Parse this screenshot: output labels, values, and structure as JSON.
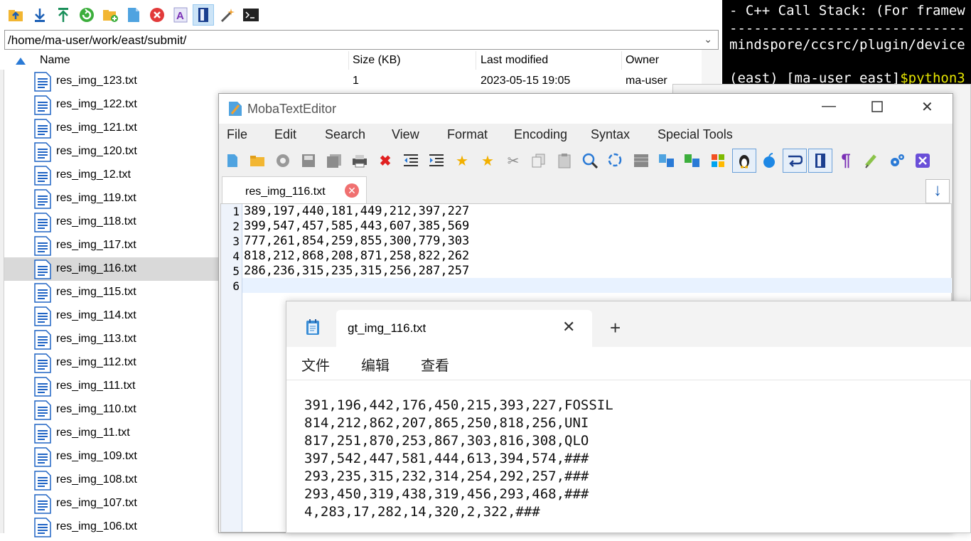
{
  "browser": {
    "path": "/home/ma-user/work/east/submit/",
    "toolbar": [
      "upload-folder-icon",
      "download-icon",
      "upload-icon",
      "refresh-icon",
      "new-folder-icon",
      "new-file-icon",
      "delete-icon",
      "rename-icon",
      "text-editor-icon",
      "magic-wand-icon",
      "terminal-icon"
    ],
    "columns": {
      "name": "Name",
      "size": "Size (KB)",
      "modified": "Last modified",
      "owner": "Owner"
    },
    "files": [
      {
        "name": "res_img_123.txt",
        "size": "1",
        "modified": "2023-05-15 19:05",
        "owner": "ma-user"
      },
      {
        "name": "res_img_122.txt"
      },
      {
        "name": "res_img_121.txt"
      },
      {
        "name": "res_img_120.txt"
      },
      {
        "name": "res_img_12.txt"
      },
      {
        "name": "res_img_119.txt"
      },
      {
        "name": "res_img_118.txt"
      },
      {
        "name": "res_img_117.txt"
      },
      {
        "name": "res_img_116.txt",
        "selected": true
      },
      {
        "name": "res_img_115.txt"
      },
      {
        "name": "res_img_114.txt"
      },
      {
        "name": "res_img_113.txt"
      },
      {
        "name": "res_img_112.txt"
      },
      {
        "name": "res_img_111.txt"
      },
      {
        "name": "res_img_110.txt"
      },
      {
        "name": "res_img_11.txt"
      },
      {
        "name": "res_img_109.txt"
      },
      {
        "name": "res_img_108.txt"
      },
      {
        "name": "res_img_107.txt"
      },
      {
        "name": "res_img_106.txt"
      }
    ]
  },
  "terminal": {
    "lines": [
      "- C++ Call Stack: (For framew",
      "-----------------------------",
      "mindspore/ccsrc/plugin/device",
      "",
      "(east) [ma-user east]"
    ],
    "prompt_cmd": "$python3"
  },
  "editor": {
    "title": "MobaTextEditor",
    "menu": [
      "File",
      "Edit",
      "Search",
      "View",
      "Format",
      "Encoding",
      "Syntax",
      "Special Tools"
    ],
    "tab": "res_img_116.txt",
    "lines": [
      "389,197,440,181,449,212,397,227",
      "399,547,457,585,443,607,385,569",
      "777,261,854,259,855,300,779,303",
      "818,212,868,208,871,258,822,262",
      "286,236,315,235,315,256,287,257",
      ""
    ]
  },
  "notepad": {
    "tab": "gt_img_116.txt",
    "menu": [
      "文件",
      "编辑",
      "查看"
    ],
    "lines": [
      "391,196,442,176,450,215,393,227,FOSSIL",
      "814,212,862,207,865,250,818,256,UNI",
      "817,251,870,253,867,303,816,308,QLO",
      "397,542,447,581,444,613,394,574,###",
      "293,235,315,232,314,254,292,257,###",
      "293,450,319,438,319,456,293,468,###",
      "4,283,17,282,14,320,2,322,###"
    ]
  }
}
